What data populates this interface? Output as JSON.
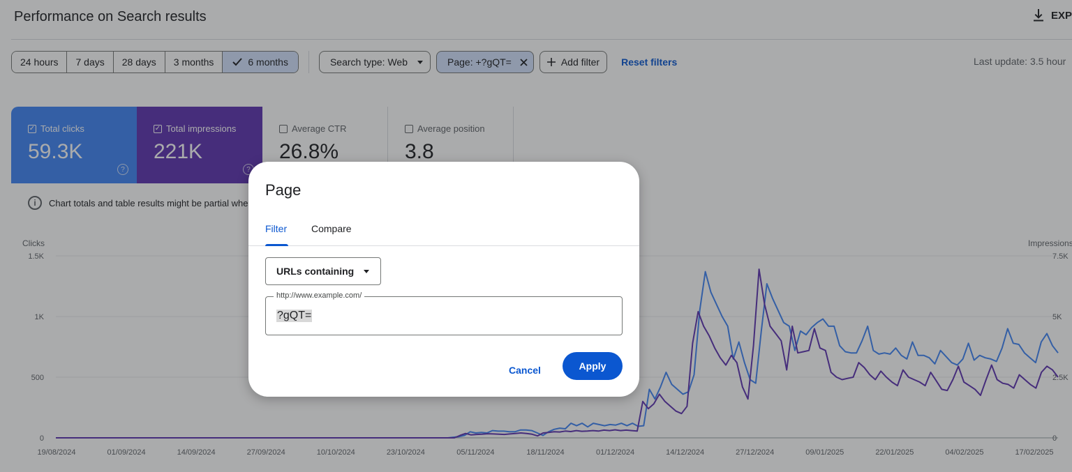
{
  "header": {
    "title": "Performance on Search results",
    "export_label": "EXP"
  },
  "date_ranges": [
    {
      "label": "24 hours",
      "active": false
    },
    {
      "label": "7 days",
      "active": false
    },
    {
      "label": "28 days",
      "active": false
    },
    {
      "label": "3 months",
      "active": false
    },
    {
      "label": "6 months",
      "active": true
    }
  ],
  "filters": {
    "search_type": "Search type: Web",
    "page_filter": "Page: +?gQT=",
    "add_filter": "Add filter",
    "reset": "Reset filters",
    "last_update": "Last update: 3.5 hour"
  },
  "metrics": {
    "clicks": {
      "label": "Total clicks",
      "value": "59.3K",
      "checked": true,
      "color": "#4285f4"
    },
    "impressions": {
      "label": "Total impressions",
      "value": "221K",
      "checked": true,
      "color": "#5e35b1"
    },
    "ctr": {
      "label": "Average CTR",
      "value": "26.8%",
      "checked": false
    },
    "position": {
      "label": "Average position",
      "value": "3.8",
      "checked": false
    }
  },
  "notice": "Chart totals and table results might be partial whe",
  "chart_data": {
    "type": "line",
    "ylabel": "Clicks",
    "y2label": "Impressions",
    "yticks": [
      "0",
      "500",
      "1K",
      "1.5K"
    ],
    "y2ticks": [
      "0",
      "2.5K",
      "5K",
      "7.5K"
    ],
    "ylim": [
      0,
      1500
    ],
    "y2lim": [
      0,
      7500
    ],
    "xticks": [
      "19/08/2024",
      "01/09/2024",
      "14/09/2024",
      "27/09/2024",
      "10/10/2024",
      "23/10/2024",
      "05/11/2024",
      "18/11/2024",
      "01/12/2024",
      "14/12/2024",
      "27/12/2024",
      "09/01/2025",
      "22/01/2025",
      "04/02/2025",
      "17/02/2025"
    ],
    "series": [
      {
        "name": "Clicks",
        "color": "#4285f4",
        "axis": "left",
        "values": [
          0,
          0,
          0,
          0,
          0,
          0,
          0,
          0,
          0,
          0,
          0,
          0,
          0,
          0,
          0,
          0,
          0,
          0,
          0,
          0,
          0,
          0,
          0,
          0,
          0,
          0,
          0,
          0,
          0,
          0,
          0,
          0,
          0,
          0,
          0,
          0,
          0,
          0,
          0,
          0,
          0,
          0,
          0,
          0,
          0,
          0,
          0,
          0,
          0,
          0,
          0,
          0,
          0,
          0,
          0,
          0,
          0,
          0,
          0,
          0,
          0,
          0,
          0,
          0,
          0,
          0,
          0,
          0,
          0,
          0,
          0,
          5,
          10,
          20,
          50,
          40,
          45,
          40,
          60,
          55,
          55,
          50,
          50,
          65,
          65,
          60,
          40,
          20,
          50,
          70,
          80,
          75,
          120,
          100,
          120,
          90,
          120,
          110,
          100,
          110,
          105,
          120,
          100,
          120,
          95,
          100,
          400,
          320,
          420,
          540,
          440,
          400,
          360,
          380,
          520,
          1050,
          1370,
          1200,
          1100,
          1000,
          920,
          650,
          790,
          620,
          480,
          450,
          880,
          1270,
          1150,
          1050,
          950,
          920,
          720,
          880,
          850,
          910,
          950,
          980,
          920,
          920,
          760,
          710,
          700,
          700,
          800,
          920,
          720,
          690,
          700,
          690,
          740,
          680,
          650,
          790,
          680,
          680,
          660,
          610,
          720,
          670,
          620,
          600,
          650,
          780,
          640,
          680,
          660,
          650,
          630,
          740,
          900,
          780,
          770,
          700,
          660,
          620,
          790,
          860,
          760,
          700
        ]
      },
      {
        "name": "Impressions",
        "color": "#5e35b1",
        "axis": "right",
        "values": [
          0,
          0,
          0,
          0,
          0,
          0,
          0,
          0,
          0,
          0,
          0,
          0,
          0,
          0,
          0,
          0,
          0,
          0,
          0,
          0,
          0,
          0,
          0,
          0,
          0,
          0,
          0,
          0,
          0,
          0,
          0,
          0,
          0,
          0,
          0,
          0,
          0,
          0,
          0,
          0,
          0,
          0,
          0,
          0,
          0,
          0,
          0,
          0,
          0,
          0,
          0,
          0,
          0,
          0,
          0,
          0,
          0,
          0,
          0,
          0,
          0,
          0,
          0,
          0,
          0,
          0,
          0,
          0,
          0,
          0,
          0,
          0,
          0,
          100,
          180,
          120,
          140,
          150,
          170,
          160,
          150,
          140,
          160,
          180,
          200,
          180,
          150,
          80,
          200,
          220,
          250,
          240,
          280,
          260,
          300,
          270,
          280,
          300,
          280,
          320,
          300,
          330,
          300,
          320,
          300,
          280,
          1500,
          1200,
          1400,
          1800,
          1500,
          1300,
          1100,
          1000,
          1300,
          3900,
          5200,
          4600,
          4200,
          3700,
          3300,
          3000,
          3400,
          3100,
          2100,
          1600,
          3800,
          6950,
          5500,
          4600,
          4300,
          4000,
          2800,
          4600,
          3500,
          3550,
          3600,
          4500,
          3700,
          3600,
          2700,
          2500,
          2400,
          2450,
          2500,
          3100,
          2900,
          2600,
          2400,
          2750,
          2500,
          2300,
          2150,
          2800,
          2500,
          2400,
          2300,
          2150,
          2700,
          2350,
          2000,
          1950,
          2400,
          2950,
          2300,
          2150,
          2000,
          1750,
          2400,
          3000,
          2400,
          2250,
          2200,
          2050,
          2600,
          2400,
          2200,
          2050,
          2700,
          2950,
          2800,
          2500
        ]
      }
    ]
  },
  "dialog": {
    "title": "Page",
    "tabs": [
      {
        "label": "Filter",
        "active": true
      },
      {
        "label": "Compare",
        "active": false
      }
    ],
    "match_type": "URLs containing",
    "field_label": "http://www.example.com/",
    "field_value": "?gQT=",
    "cancel": "Cancel",
    "apply": "Apply"
  }
}
